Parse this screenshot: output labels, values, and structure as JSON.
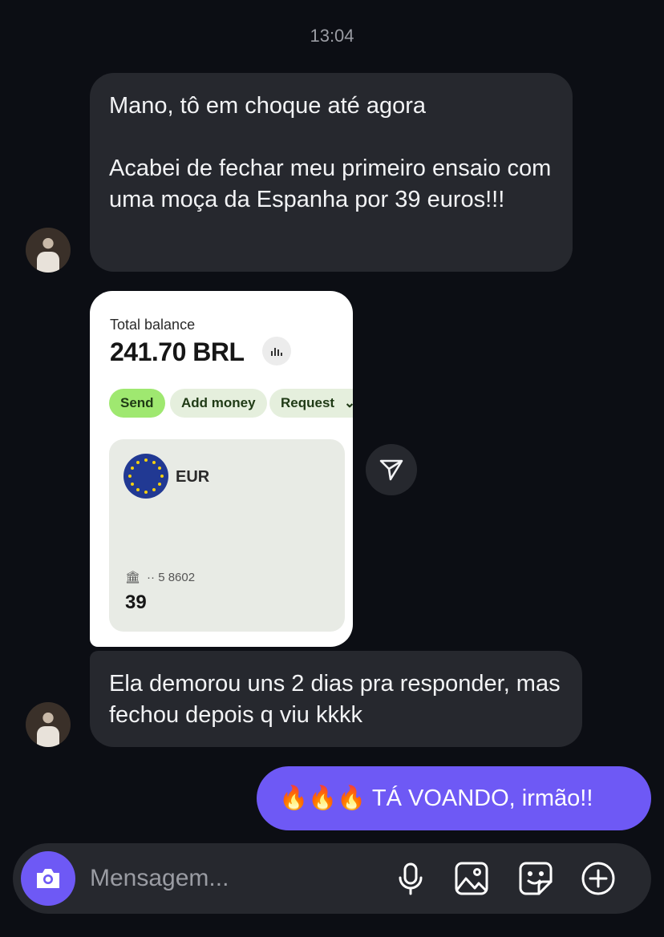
{
  "chat": {
    "timestamp": "13:04",
    "messages": [
      {
        "text": "Mano, tô em choque até agora\n\nAcabei de fechar meu primeiro ensaio com uma moça da Espanha por 39 euros!!!"
      },
      {
        "text": "Ela demorou uns 2 dias pra responder, mas fechou depois q viu kkkk"
      }
    ],
    "outgoing": {
      "text": "🔥🔥🔥 TÁ VOANDO, irmão!!"
    },
    "screenshot": {
      "total_balance_label": "Total balance",
      "total_balance_amount": "241.70 BRL",
      "buttons": {
        "send": "Send",
        "add_money": "Add money",
        "request": "Request"
      },
      "currency": "EUR",
      "account": "·· 5 8602",
      "card_amount": "39"
    }
  },
  "composer": {
    "placeholder": "Mensagem..."
  },
  "icons": {
    "camera": "camera-icon",
    "mic": "microphone-icon",
    "image": "image-icon",
    "sticker": "sticker-icon",
    "plus": "add-icon",
    "share": "send-arrow-icon"
  },
  "colors": {
    "accent": "#6e59f5",
    "bubble": "#26282e",
    "background": "#0c0e14"
  }
}
